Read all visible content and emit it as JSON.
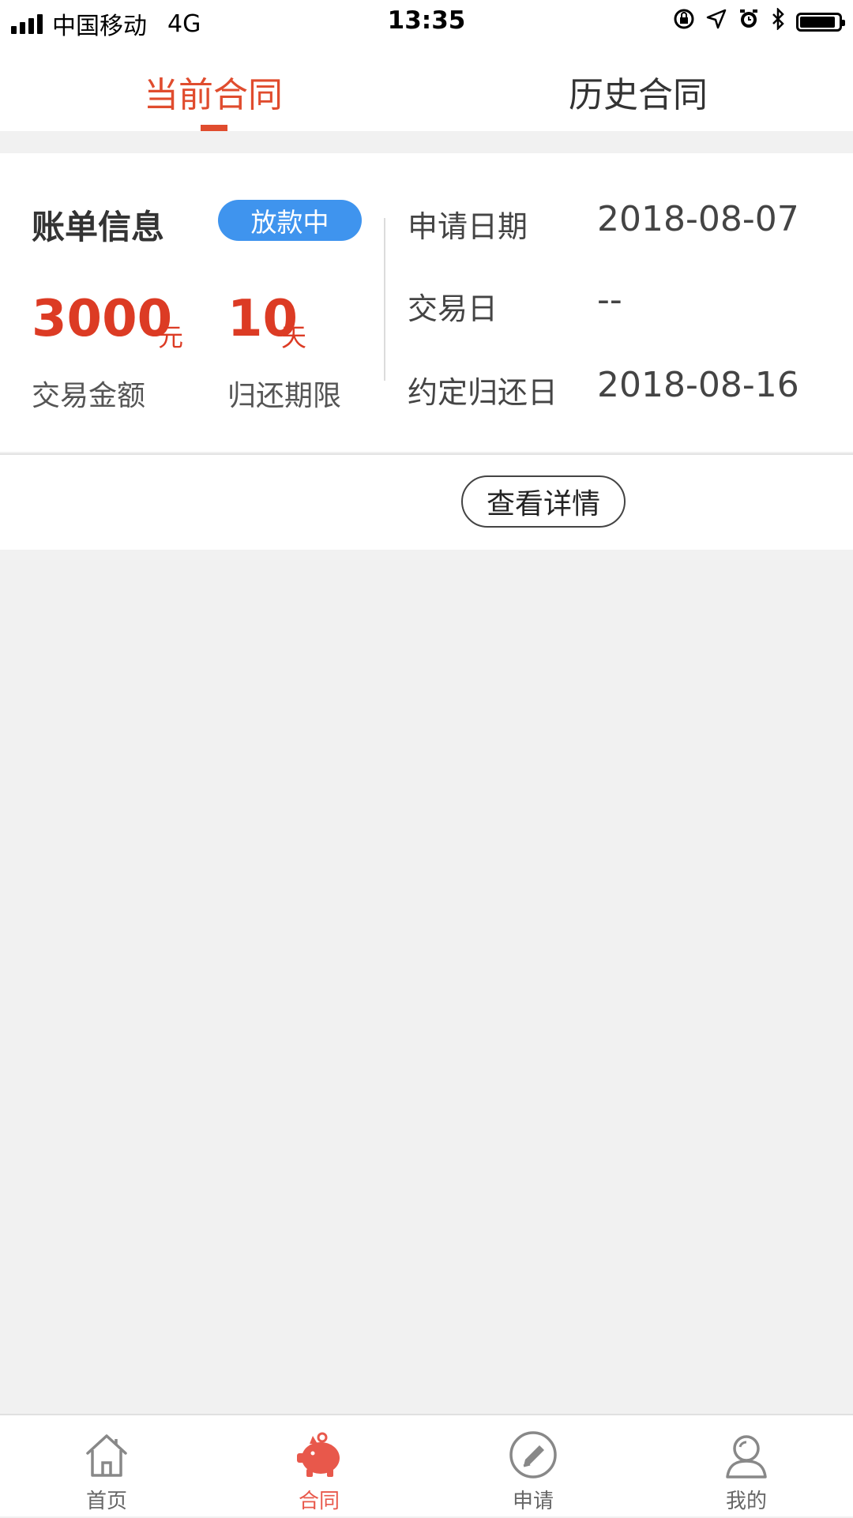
{
  "status_bar": {
    "carrier": "中国移动",
    "network": "4G",
    "time": "13:35"
  },
  "tabs": [
    {
      "label": "当前合同",
      "active": true
    },
    {
      "label": "历史合同",
      "active": false
    }
  ],
  "bill": {
    "title": "账单信息",
    "status": "放款中",
    "amount": "3000",
    "amount_unit": "元",
    "amount_label": "交易金额",
    "term": "10",
    "term_unit": "天",
    "term_label": "归还期限",
    "info": [
      {
        "label": "申请日期",
        "value": "2018-08-07"
      },
      {
        "label": "交易日",
        "value": "--"
      },
      {
        "label": "约定归还日",
        "value": "2018-08-16"
      }
    ]
  },
  "detail_button": "查看详情",
  "bottom_nav": [
    {
      "label": "首页",
      "icon": "home-icon",
      "active": false
    },
    {
      "label": "合同",
      "icon": "piggy-bank-icon",
      "active": true
    },
    {
      "label": "申请",
      "icon": "pencil-icon",
      "active": false
    },
    {
      "label": "我的",
      "icon": "user-icon",
      "active": false
    }
  ],
  "colors": {
    "accent": "#e04c2e",
    "badge": "#3f94ee",
    "nav_active": "#e8584b",
    "background": "#f1f1f1"
  }
}
